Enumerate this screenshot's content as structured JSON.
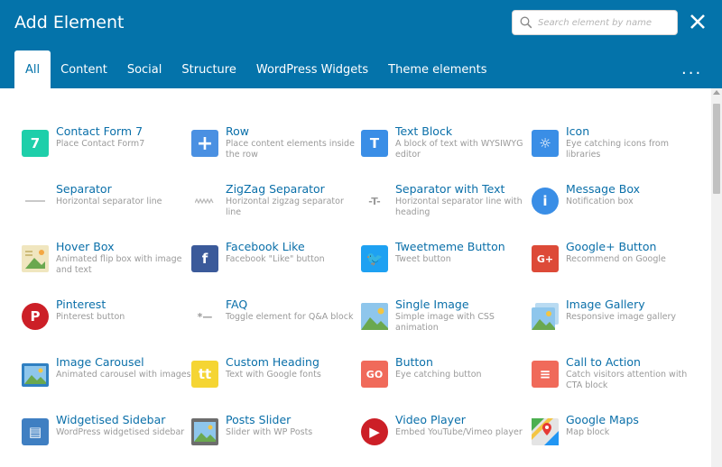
{
  "header": {
    "title": "Add Element",
    "search_placeholder": "Search element by name",
    "more_label": "..."
  },
  "tabs": [
    {
      "label": "All",
      "active": true
    },
    {
      "label": "Content"
    },
    {
      "label": "Social"
    },
    {
      "label": "Structure"
    },
    {
      "label": "WordPress Widgets"
    },
    {
      "label": "Theme elements"
    }
  ],
  "elements": [
    {
      "name": "Contact Form 7",
      "desc": "Place Contact Form7",
      "icon": "contact-form-7-icon",
      "color": "#1ecfaa",
      "glyph": "7"
    },
    {
      "name": "Row",
      "desc": "Place content elements inside the row",
      "icon": "row-plus-icon",
      "color": "#4a90e2",
      "glyph": "+"
    },
    {
      "name": "Text Block",
      "desc": "A block of text with WYSIWYG editor",
      "icon": "text-block-icon",
      "color": "#3a8ee6",
      "glyph": "T"
    },
    {
      "name": "Icon",
      "desc": "Eye catching icons from libraries",
      "icon": "icon-sun-icon",
      "color": "#3a8ee6",
      "glyph": "☼"
    },
    {
      "name": "Separator",
      "desc": "Horizontal separator line",
      "icon": "separator-icon",
      "color": "#ffffff",
      "glyph": ""
    },
    {
      "name": "ZigZag Separator",
      "desc": "Horizontal zigzag separator line",
      "icon": "zigzag-separator-icon",
      "color": "#ffffff",
      "glyph": "〰"
    },
    {
      "name": "Separator with Text",
      "desc": "Horizontal separator line with heading",
      "icon": "separator-text-icon",
      "color": "#ffffff",
      "glyph": "-T-"
    },
    {
      "name": "Message Box",
      "desc": "Notification box",
      "icon": "info-icon",
      "color": "#3a8ee6",
      "glyph": "i"
    },
    {
      "name": "Hover Box",
      "desc": "Animated flip box with image and text",
      "icon": "hover-box-icon",
      "color": "#e8dca9",
      "glyph": ""
    },
    {
      "name": "Facebook Like",
      "desc": "Facebook \"Like\" button",
      "icon": "facebook-icon",
      "color": "#3b5a9a",
      "glyph": "f"
    },
    {
      "name": "Tweetmeme Button",
      "desc": "Tweet button",
      "icon": "twitter-icon",
      "color": "#1ea1f2",
      "glyph": "🐦"
    },
    {
      "name": "Google+ Button",
      "desc": "Recommend on Google",
      "icon": "google-plus-icon",
      "color": "#dd4a38",
      "glyph": "G+"
    },
    {
      "name": "Pinterest",
      "desc": "Pinterest button",
      "icon": "pinterest-icon",
      "color": "#cc1f27",
      "glyph": "P"
    },
    {
      "name": "FAQ",
      "desc": "Toggle element for Q&A block",
      "icon": "faq-toggle-icon",
      "color": "#ffffff",
      "glyph": "*—"
    },
    {
      "name": "Single Image",
      "desc": "Simple image with CSS animation",
      "icon": "single-image-icon",
      "color": "#5aa9e6",
      "glyph": ""
    },
    {
      "name": "Image Gallery",
      "desc": "Responsive image gallery",
      "icon": "image-gallery-icon",
      "color": "#5aa9e6",
      "glyph": ""
    },
    {
      "name": "Image Carousel",
      "desc": "Animated carousel with images",
      "icon": "image-carousel-icon",
      "color": "#5aa9e6",
      "glyph": ""
    },
    {
      "name": "Custom Heading",
      "desc": "Text with Google fonts",
      "icon": "custom-heading-icon",
      "color": "#f5d533",
      "glyph": "tt"
    },
    {
      "name": "Button",
      "desc": "Eye catching button",
      "icon": "go-button-icon",
      "color": "#f06a5a",
      "glyph": "GO"
    },
    {
      "name": "Call to Action",
      "desc": "Catch visitors attention with CTA block",
      "icon": "call-to-action-icon",
      "color": "#f06a5a",
      "glyph": "≡"
    },
    {
      "name": "Widgetised Sidebar",
      "desc": "WordPress widgetised sidebar",
      "icon": "sidebar-icon",
      "color": "#3f7fc2",
      "glyph": "▤"
    },
    {
      "name": "Posts Slider",
      "desc": "Slider with WP Posts",
      "icon": "posts-slider-icon",
      "color": "#5aa9e6",
      "glyph": ""
    },
    {
      "name": "Video Player",
      "desc": "Embed YouTube/Vimeo player",
      "icon": "video-play-icon",
      "color": "#cc1f27",
      "glyph": "▶"
    },
    {
      "name": "Google Maps",
      "desc": "Map block",
      "icon": "google-maps-icon",
      "color": "#4caf50",
      "glyph": "⚲"
    }
  ]
}
